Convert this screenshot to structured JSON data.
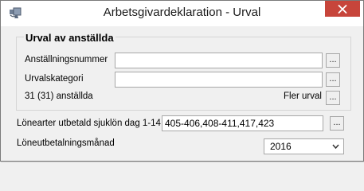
{
  "window": {
    "title": "Arbetsgivardeklaration - Urval"
  },
  "icons": {
    "app": "window-app-icon",
    "close": "close-icon"
  },
  "employees_group": {
    "legend": "Urval av anställda",
    "employment_number_label": "Anställningsnummer",
    "employment_number_value": "",
    "category_label": "Urvalskategori",
    "category_value": "",
    "count_text": "31 (31) anställda",
    "more_selection_label": "Fler urval",
    "browse_label": "..."
  },
  "wage_types": {
    "label": "Lönearter utbetald sjuklön dag 1-14",
    "value": "405-406,408-411,417,423",
    "browse_label": "..."
  },
  "payment_month": {
    "label": "Löneutbetalningsmånad",
    "selected": "2016"
  },
  "colors": {
    "close_button": "#c7453b",
    "window_border": "#7a7a7a",
    "background": "#f0f0f0"
  }
}
